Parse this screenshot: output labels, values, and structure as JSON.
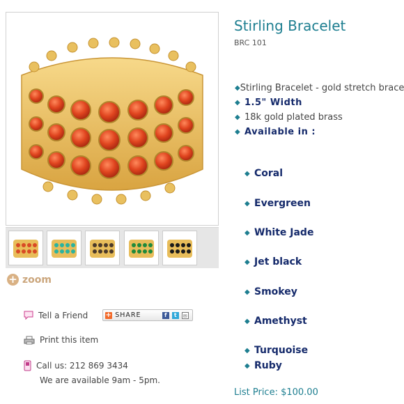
{
  "product": {
    "title": "Stirling Bracelet",
    "sku": "BRC 101",
    "details": [
      {
        "text": "Stirling Bracelet - gold stretch bracelet",
        "bold": false
      },
      {
        "text": "1.5\" Width",
        "bold": true
      },
      {
        "text": "18k gold plated brass",
        "bold": false
      },
      {
        "text": "Available in :",
        "bold": true
      }
    ],
    "colors": [
      "Coral",
      "Evergreen",
      "White Jade",
      "Jet black",
      "Smokey",
      "Amethyst",
      "Turquoise",
      "Ruby"
    ],
    "list_price": "List Price: $100.00"
  },
  "gallery": {
    "zoom_label": "zoom",
    "thumbnails": [
      {
        "name": "coral",
        "stone": "#d94a25"
      },
      {
        "name": "turquoise",
        "stone": "#2bb3a0"
      },
      {
        "name": "smokey",
        "stone": "#4b3a2a"
      },
      {
        "name": "evergreen",
        "stone": "#1f8a3c"
      },
      {
        "name": "jet-black",
        "stone": "#1a1a1a"
      }
    ]
  },
  "actions": {
    "tell_friend": "Tell a Friend",
    "share": "SHARE",
    "print": "Print this item",
    "call": "Call us: 212 869 3434",
    "hours": "We are available 9am - 5pm."
  },
  "colors": {
    "accent": "#1d7e90",
    "navy": "#152a6b",
    "gold": "#e8bd5a",
    "coral": "#d94a25"
  }
}
